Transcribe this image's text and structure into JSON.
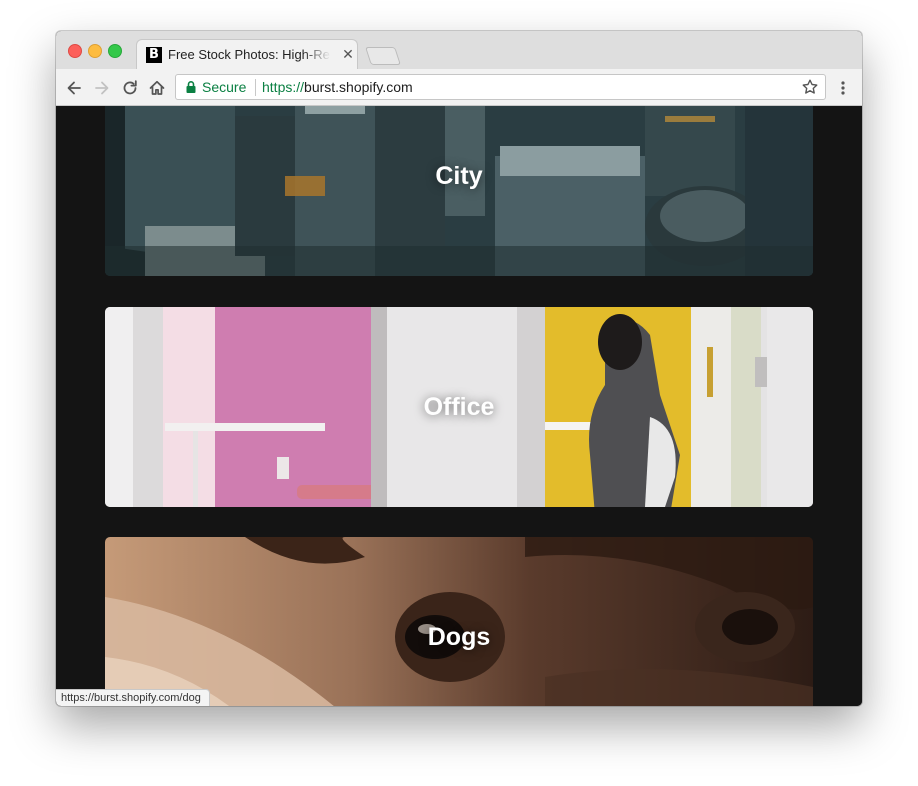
{
  "browser": {
    "tab": {
      "favicon_letter": "B",
      "title": "Free Stock Photos: High-Res Images"
    },
    "address_bar": {
      "secure_label": "Secure",
      "url_scheme": "https://",
      "url_host": "burst.shopify.com"
    },
    "status_url": "https://burst.shopify.com/dog"
  },
  "categories": [
    {
      "label": "City"
    },
    {
      "label": "Office"
    },
    {
      "label": "Dogs"
    }
  ],
  "colors": {
    "page_background": "#141414",
    "secure_green": "#0b8043"
  }
}
